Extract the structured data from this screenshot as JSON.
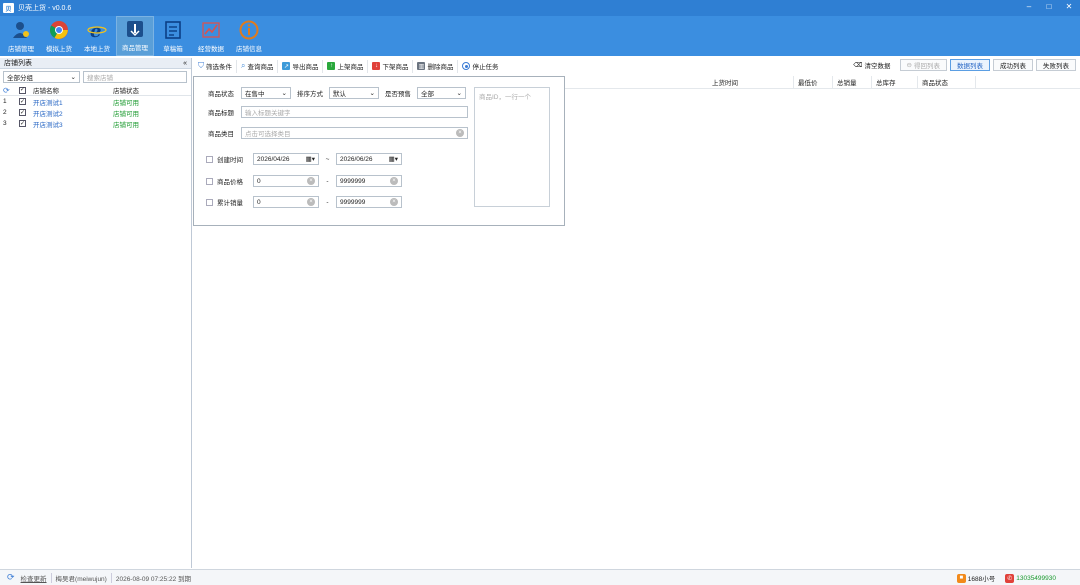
{
  "window": {
    "title": "贝壳上货 - v0.0.6",
    "app_icon": "贝",
    "controls": [
      "minimize-icon",
      "maximize-icon",
      "close-icon"
    ]
  },
  "ribbon": {
    "items": [
      {
        "label": "店铺管理",
        "icon": "store-manage-icon"
      },
      {
        "label": "模拟上货",
        "icon": "chrome-icon"
      },
      {
        "label": "本地上货",
        "icon": "ie-icon"
      },
      {
        "label": "商品管理",
        "icon": "product-manage-icon",
        "active": true
      },
      {
        "label": "草稿箱",
        "icon": "draft-icon"
      },
      {
        "label": "经营数据",
        "icon": "chart-icon"
      },
      {
        "label": "店铺信息",
        "icon": "info-icon"
      }
    ]
  },
  "left_panel": {
    "title": "店铺列表",
    "collapse": "«",
    "group_select": "全部分组",
    "search_placeholder": "搜索店铺",
    "headers": {
      "name": "店铺名称",
      "status": "店铺状态"
    },
    "rows": [
      {
        "num": "1",
        "checked": true,
        "name": "开店测试1",
        "status": "店铺可用"
      },
      {
        "num": "2",
        "checked": true,
        "name": "开店测试2",
        "status": "店铺可用"
      },
      {
        "num": "3",
        "checked": true,
        "name": "开店测试3",
        "status": "店铺可用"
      }
    ]
  },
  "toolbar": {
    "buttons": [
      {
        "label": "筛选条件",
        "icon": "filter-icon",
        "color": "#3a7bd5"
      },
      {
        "label": "查询商品",
        "icon": "search-icon",
        "color": "#4a8fd8"
      },
      {
        "label": "导出商品",
        "icon": "export-icon",
        "color": "#3d9bd9"
      },
      {
        "label": "上架商品",
        "icon": "arrow-up-icon",
        "color": "#2aa83c"
      },
      {
        "label": "下架商品",
        "icon": "arrow-down-icon",
        "color": "#e0413a"
      },
      {
        "label": "删除商品",
        "icon": "trash-icon",
        "color": "#6b7480"
      },
      {
        "label": "停止任务",
        "icon": "stop-icon",
        "color": "#3a7bd5"
      }
    ],
    "right": {
      "clear": "清空数据",
      "recycle": "得回列表",
      "data_list": "数据列表",
      "success_list": "成功列表",
      "fail_list": "失败列表"
    }
  },
  "filter": {
    "status_label": "商品状态",
    "status_value": "在售中",
    "sort_label": "排序方式",
    "sort_value": "默认",
    "presale_label": "是否预售",
    "presale_value": "全部",
    "title_label": "商品标题",
    "title_placeholder": "输入标题关键字",
    "category_label": "商品类目",
    "category_placeholder": "点击可选择类目",
    "created_label": "创建时间",
    "date_from": "2026/04/26",
    "date_tilde": "~",
    "date_to": "2026/06/26",
    "price_label": "商品价格",
    "price_min": "0",
    "price_max": "9999999",
    "sales_label": "累计销量",
    "sales_min": "0",
    "sales_max": "9999999",
    "range_dash": "-",
    "ids_placeholder": "商品ID，一行一个"
  },
  "grid": {
    "headers": [
      "上货时间",
      "最低价",
      "总销量",
      "总库存",
      "商品状态"
    ]
  },
  "status_bar": {
    "check_update": "检查更新",
    "user": "梅吴君(meiwujun)",
    "expire": "2026-08-09 07:25:22 到期",
    "account_badge": "1688小号",
    "phone": "13035499930",
    "accent_orange": "#f28a1b",
    "accent_red": "#e0413a"
  }
}
